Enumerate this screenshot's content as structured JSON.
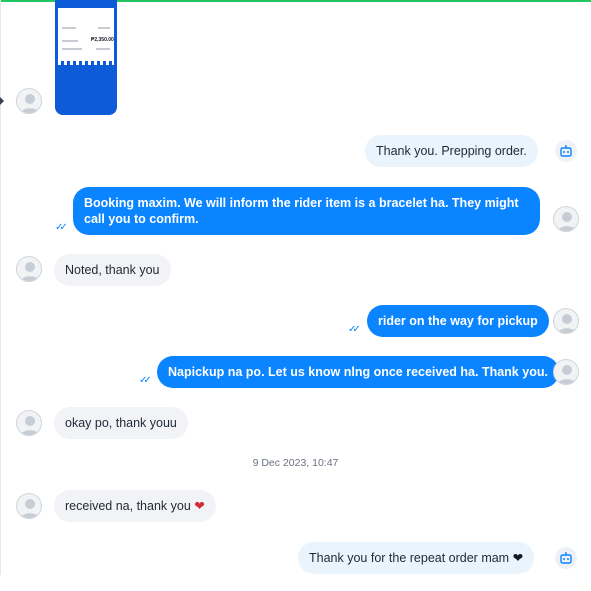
{
  "attachment": {
    "amount": "₱2,350.00"
  },
  "messages": [
    {
      "text": "Thank you. Prepping order."
    },
    {
      "text": "Booking maxim. We will inform the rider item is a bracelet ha. They might call you to confirm."
    },
    {
      "text": "Noted, thank you"
    },
    {
      "text": "rider on the way for pickup"
    },
    {
      "text": "Napickup na po. Let us know nlng once received ha. Thank you."
    },
    {
      "text": "okay po, thank youu"
    },
    {
      "text": "received na, thank you",
      "emoji": "❤"
    },
    {
      "text": "Thank you for the repeat order mam",
      "emoji": "❤"
    }
  ],
  "date_separator": "9 Dec 2023, 10:47",
  "colors": {
    "outgoing": "#0a84ff",
    "incoming": "#f1f3f6",
    "accent_bar": "#22c55e"
  }
}
